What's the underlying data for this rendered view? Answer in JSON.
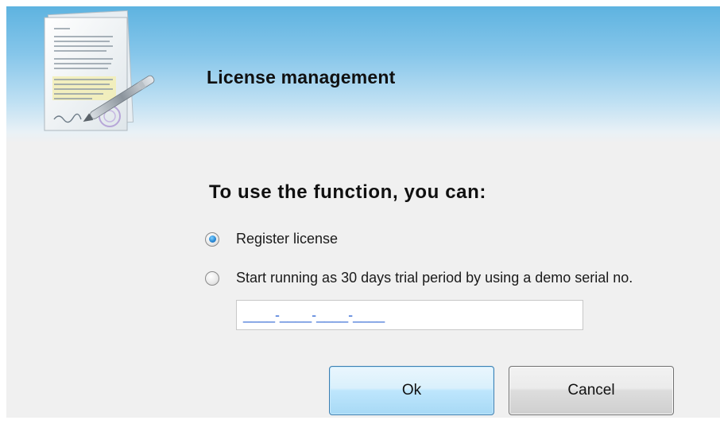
{
  "header": {
    "title": "License management",
    "icon": "document-signature-icon"
  },
  "body": {
    "prompt": "To use the function, you can:",
    "options": [
      {
        "label": "Register license",
        "selected": true
      },
      {
        "label": "Start running as 30 days trial period by using a demo serial no.",
        "selected": false
      }
    ],
    "serial_input": {
      "value": "",
      "mask": "____-____-____-____"
    }
  },
  "buttons": {
    "ok_label": "Ok",
    "cancel_label": "Cancel"
  },
  "colors": {
    "header_top": "#5eb3e0",
    "dialog_bg": "#f0f0f0",
    "ok_border": "#3c7fb1",
    "radio_accent": "#2a8ad6",
    "mask_color": "#3b6fd6"
  }
}
